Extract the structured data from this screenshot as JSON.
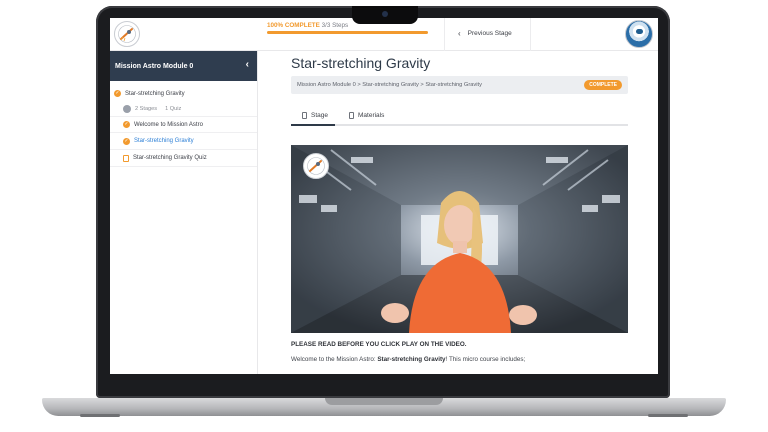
{
  "topbar": {
    "logo_icon": "mission-astro-logo",
    "progress_percent_label": "100% COMPLETE",
    "progress_steps_label": "3/3 Steps",
    "progress_fraction": 1.0,
    "previous_stage_label": "Previous Stage",
    "avatar_icon": "astronaut-avatar"
  },
  "sidebar": {
    "module_title": "Mission Astro Module 0",
    "lesson": {
      "label": "Star-stretching Gravity",
      "completed": true
    },
    "meta": {
      "stages": "2 Stages",
      "quizzes": "1 Quiz"
    },
    "topics": [
      {
        "label": "Welcome to Mission Astro",
        "completed": true,
        "active": false
      },
      {
        "label": "Star-stretching Gravity",
        "completed": true,
        "active": true
      },
      {
        "label": "Star-stretching Gravity Quiz",
        "type": "quiz",
        "active": false
      }
    ]
  },
  "main": {
    "title": "Star-stretching Gravity",
    "breadcrumb": "Mission Astro Module 0 > Star-stretching Gravity > Star-stretching Gravity",
    "status_badge": "COMPLETE",
    "tabs": [
      {
        "label": "Stage",
        "active": true
      },
      {
        "label": "Materials",
        "active": false
      }
    ],
    "notice": "PLEASE READ BEFORE YOU CLICK PLAY ON THE VIDEO.",
    "intro_prefix": "Welcome to the Mission Astro: ",
    "intro_bold": "Star-stretching Gravity",
    "intro_suffix": "! This micro course includes;"
  },
  "colors": {
    "accent": "#f29a2e",
    "sidebar_header": "#2f3d4f",
    "active_link": "#2c7fd6"
  }
}
